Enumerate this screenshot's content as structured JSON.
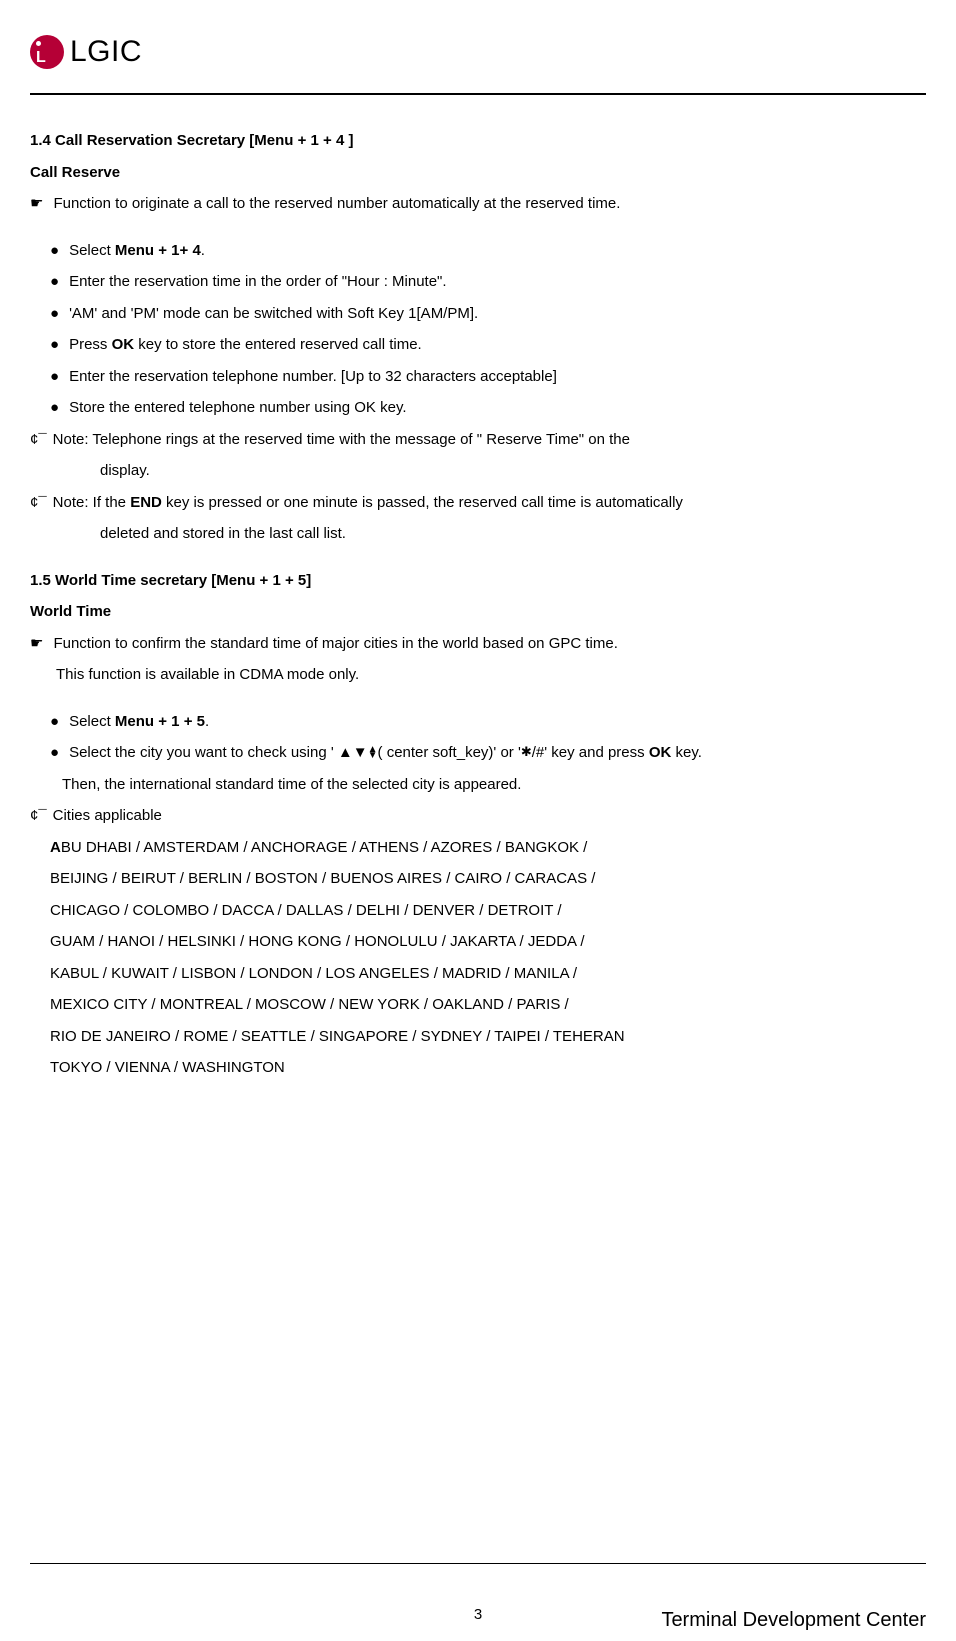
{
  "brand": "LGIC",
  "section14": {
    "heading": "1.4   Call Reservation Secretary [Menu + 1 + 4 ]",
    "subheading": "Call Reserve",
    "intro": "Function to originate a call to the reserved number automatically at the reserved time.",
    "bullets": [
      {
        "prefix": "Select ",
        "bold": "Menu + 1+ 4",
        "suffix": "."
      },
      {
        "text": "Enter the reservation time in the order of \"Hour : Minute\"."
      },
      {
        "text": "'AM' and 'PM' mode can be switched with Soft Key 1[AM/PM]."
      },
      {
        "prefix": "Press ",
        "bold": "OK",
        "suffix": " key to store the entered reserved call time."
      },
      {
        "text": "Enter the reservation telephone number. [Up to 32 characters acceptable]"
      },
      {
        "text": "Store the entered telephone number using OK key."
      }
    ],
    "notes": [
      {
        "line1": "Note: Telephone rings at the reserved time with the message of \" Reserve Time\" on the",
        "line2": "display."
      },
      {
        "line1_prefix": "Note: If the ",
        "line1_bold": "END",
        "line1_suffix": " key is pressed or one minute is passed, the reserved call time is automatically",
        "line2": "deleted and stored in the last call list."
      }
    ]
  },
  "section15": {
    "heading": "1.5   World Time secretary   [Menu + 1 + 5]",
    "subheading": "World Time",
    "intro1": "Function to confirm the standard time of major cities in the world based on GPC time.",
    "intro2": "This function is available in CDMA mode only.",
    "bullets": [
      {
        "prefix": "Select ",
        "bold": "Menu + 1 + 5",
        "suffix": "."
      },
      {
        "part1": "Select the city you want to check using ' ",
        "arrow": "⯅⯆",
        "part2": "( center soft_key)' or '",
        "star": "✱",
        "part3": "/#' key and press ",
        "bold": "OK",
        "part4": " key."
      }
    ],
    "bullet2_continue": "Then, the international standard time of the selected city is appeared.",
    "cities_label": "Cities applicable",
    "cities_first_bold": "A",
    "cities": [
      "BU DHABI / AMSTERDAM / ANCHORAGE / ATHENS / AZORES / BANGKOK /",
      "BEIJING / BEIRUT / BERLIN / BOSTON / BUENOS AIRES / CAIRO / CARACAS /",
      "CHICAGO / COLOMBO / DACCA / DALLAS / DELHI / DENVER / DETROIT /",
      "GUAM / HANOI / HELSINKI / HONG KONG / HONOLULU / JAKARTA / JEDDA /",
      "KABUL / KUWAIT / LISBON / LONDON / LOS ANGELES / MADRID / MANILA /",
      "MEXICO CITY / MONTREAL / MOSCOW / NEW YORK / OAKLAND / PARIS /",
      "RIO DE JANEIRO / ROME / SEATTLE / SINGAPORE / SYDNEY / TAIPEI / TEHERAN",
      "TOKYO / VIENNA / WASHINGTON"
    ]
  },
  "footer": {
    "page": "3",
    "right": "Terminal Development Center"
  },
  "symbols": {
    "pointer": "☛",
    "bullet": "●",
    "note_prefix": "¢¯"
  }
}
